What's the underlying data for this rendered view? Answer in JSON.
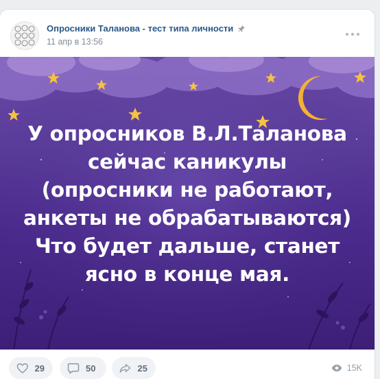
{
  "post": {
    "author": "Опросники Таланова - тест типа личности",
    "date": "11 апр в 13:56",
    "image_text": [
      "У опросников В.Л.Таланова",
      "сейчас каникулы",
      "(опросники не работают,",
      "анкеты не обрабатываются)",
      "Что будет дальше, станет",
      "ясно в конце мая."
    ]
  },
  "actions": {
    "likes": "29",
    "comments": "50",
    "shares": "25",
    "views": "15K"
  },
  "icons": {
    "pin": "pin-icon",
    "more": "more-icon",
    "like": "heart-icon",
    "comment": "comment-icon",
    "share": "share-icon",
    "views": "eye-icon"
  },
  "colors": {
    "author": "#2a5885",
    "muted": "#818c99",
    "background_top": "#6a4aa6",
    "background_bottom": "#3d1f78",
    "star": "#f5c242",
    "moon": "#f2b233"
  }
}
